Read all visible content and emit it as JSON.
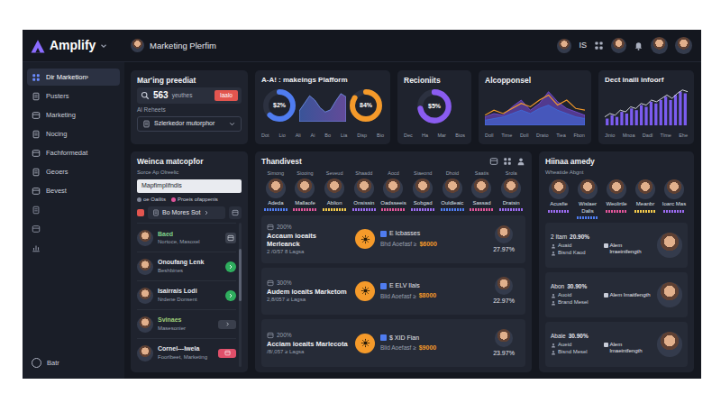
{
  "topbar": {
    "logo": "Amplify",
    "title": "Marketing Plerfim",
    "initials": "IS"
  },
  "sidebar": {
    "items": [
      {
        "label": "Dir Marketion›",
        "selected": true
      },
      {
        "label": "Pusters",
        "selected": false
      },
      {
        "label": "Marketing",
        "selected": false
      },
      {
        "label": "Nocing",
        "selected": false
      },
      {
        "label": "Fachformedat",
        "selected": false
      },
      {
        "label": "Geoers",
        "selected": false
      },
      {
        "label": "Bevest",
        "selected": false
      }
    ],
    "footer": "Batr"
  },
  "overview": {
    "title": "Mar'ing preediat",
    "count": "563",
    "count_label": "yeuthes",
    "button": "Iaalo",
    "sub_label": "Al Reheets",
    "dropdown": "Szlerkedor mutorphor"
  },
  "platform": {
    "title": "A-A! : makeings Plafform",
    "donuts": [
      {
        "label": "$2%",
        "level": 0.62,
        "color": "#4f7cf0"
      },
      {
        "label": "84%",
        "level": 0.84,
        "color": "#f59a2a"
      }
    ],
    "wave": [
      20,
      34,
      48,
      40,
      26,
      18,
      22,
      38,
      52,
      46
    ],
    "x_labels": [
      "Dot",
      "Lio",
      "Ali",
      "Ai",
      "Bo",
      "Lia",
      "Disp",
      "Bio"
    ]
  },
  "recipients": {
    "title": "Recioniits",
    "donut": {
      "label": "$5%",
      "level": 0.72
    },
    "x_labels": [
      "Dec",
      "Ha",
      "Mar",
      "Bios"
    ]
  },
  "allocation": {
    "title": "Alcopponsel",
    "series": [
      {
        "kind": "area",
        "color": "#7b4fe0",
        "values": [
          10,
          14,
          12,
          22,
          30,
          18,
          26,
          40,
          28,
          20,
          16,
          12
        ]
      },
      {
        "kind": "area",
        "color": "#3c6fe0",
        "values": [
          6,
          8,
          10,
          14,
          18,
          14,
          20,
          24,
          18,
          14,
          10,
          8
        ]
      },
      {
        "kind": "line",
        "color": "#f59a2a",
        "values": [
          12,
          18,
          14,
          20,
          26,
          22,
          30,
          36,
          24,
          30,
          20,
          18
        ]
      }
    ],
    "x_labels": [
      "Doll",
      "Time",
      "Doll",
      "Drato",
      "Tiea",
      "Fbon"
    ]
  },
  "direct": {
    "title": "Dect inaili infoorf",
    "bars": [
      8,
      12,
      10,
      16,
      14,
      20,
      18,
      24,
      22,
      28,
      26,
      30,
      34,
      30,
      36,
      40,
      38
    ],
    "line": [
      10,
      14,
      12,
      18,
      16,
      22,
      20,
      26,
      24,
      30,
      28,
      32,
      36,
      32,
      38,
      42,
      40
    ],
    "x_labels": [
      "Jinio",
      "Mnoa",
      "Dadl",
      "Tlme",
      "Ehe"
    ]
  },
  "matcher": {
    "title": "Weinca matcopfor",
    "caption": "Sorce Ap Olreelic",
    "input": "Mapfimplifndis",
    "filters": [
      {
        "label": "oe Oailits",
        "color": "#7f8596"
      },
      {
        "label": "Proeis ofappenis",
        "color": "#e0559a"
      }
    ],
    "button": "Bo Mores Sot",
    "people": [
      {
        "name": "Baed",
        "role": "Nortoce, Masoxel",
        "color": "#7fd08a",
        "kind": "box"
      },
      {
        "name": "Onoufang Lenk",
        "role": "Beshbines",
        "color": "#e8eaf0",
        "kind": "green"
      },
      {
        "name": "Isairrais Lodi",
        "role": "Nrdene Donsent",
        "color": "#e8eaf0",
        "kind": "green"
      },
      {
        "name": "Svinaes",
        "role": "Masesonier",
        "color": "#9fd07a",
        "kind": "pill"
      },
      {
        "name": "Cornel---lwela",
        "role": "Foorlbeet, Marketing",
        "color": "#e8eaf0",
        "kind": "red"
      }
    ]
  },
  "team": {
    "title": "Thandivest",
    "members": [
      {
        "tag": "Simong",
        "name": "Adeda",
        "color": "#4f7cf0"
      },
      {
        "tag": "Siooing",
        "name": "Mallaofe",
        "color": "#e0559a"
      },
      {
        "tag": "Seveud",
        "name": "Ablion",
        "color": "#f2c94c"
      },
      {
        "tag": "Shaadd",
        "name": "Onsissin",
        "color": "#9b6bf0"
      },
      {
        "tag": "Aocd",
        "name": "Oadsseeis",
        "color": "#e0559a"
      },
      {
        "tag": "Siaeond",
        "name": "Sobgad",
        "color": "#9b6bf0"
      },
      {
        "tag": "Dhoid",
        "name": "Ouldleaic",
        "color": "#4f7cf0"
      },
      {
        "tag": "Saatis",
        "name": "Sassad",
        "color": "#e0559a"
      },
      {
        "tag": "Srola",
        "name": "Dratsin",
        "color": "#9b6bf0"
      }
    ],
    "campaigns": [
      {
        "rank": "200%",
        "name": "Accaum ioeaits Merleanck",
        "date": "2 /0/57 8 Lagsa",
        "badge": "E Icbasses",
        "budget_label": "Bhd Aoefasf ≥",
        "budget": "$6000",
        "rate": "27.97%"
      },
      {
        "rank": "300%",
        "name": "Audem ioeaits Marketom",
        "date": "2,8/057 ≥ Lagsa",
        "badge": "E ELV Ilais",
        "budget_label": "Blid Aoefasf ≥",
        "budget": "$8000",
        "rate": "22.97%"
      },
      {
        "rank": "200%",
        "name": "Acciam ioeaits Marlecota",
        "date": "/8/,057 ≥ Lagsa",
        "badge": "$ XID Fian",
        "budget_label": "Blid Aoefasf ≥",
        "budget": "$9000",
        "rate": "23.97%"
      }
    ]
  },
  "right": {
    "title": "Hiinaa amedy",
    "subtitle": "Wheatide Abgnt",
    "members": [
      {
        "name": "Acusfie",
        "color": "#9b6bf0"
      },
      {
        "name": "Wislaer Dalis",
        "color": "#4f7cf0"
      },
      {
        "name": "Weolirtle",
        "color": "#e0559a"
      },
      {
        "name": "Meanbr",
        "color": "#f2c94c"
      },
      {
        "name": "Ioarc Mas",
        "color": "#9b6bf0"
      }
    ],
    "cards": [
      {
        "rank": "2 Itam",
        "pct": "20.90%",
        "title": "Alem lrraeintfength",
        "lines": [
          "Auaid",
          "Bisnd Kaod"
        ]
      },
      {
        "rank": "Abon",
        "pct": "30.90%",
        "title": "Alem Imaitfength",
        "lines": [
          "Auoid",
          "Brand Mesel"
        ]
      },
      {
        "rank": "Abaie",
        "pct": "30.90%",
        "title": "Alem lmaeintfength",
        "lines": [
          "Aueid",
          "Bisnd Mesel"
        ]
      }
    ]
  }
}
